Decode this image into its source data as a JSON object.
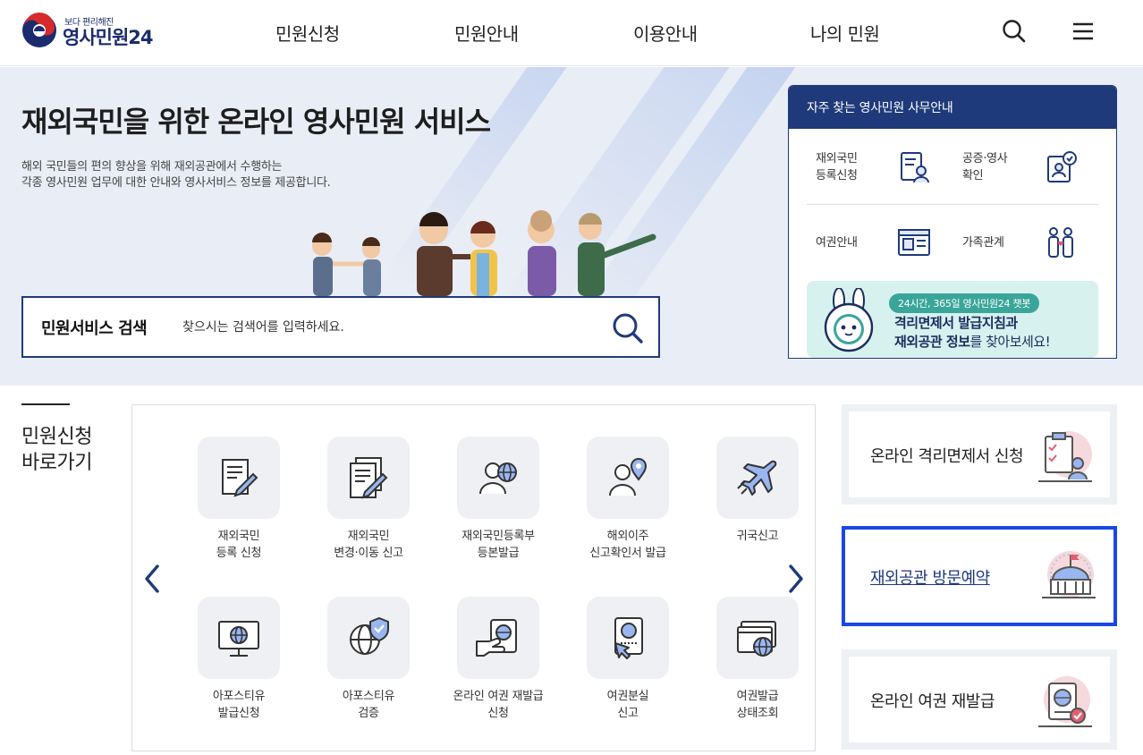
{
  "header": {
    "logo_sub": "보다 편리해진",
    "logo_main": "영사민원24",
    "nav": [
      "민원신청",
      "민원안내",
      "이용안내",
      "나의 민원"
    ]
  },
  "hero": {
    "title": "재외국민을 위한 온라인 영사민원 서비스",
    "desc_line1": "해외 국민들의 편의 향상을 위해 재외공관에서 수행하는",
    "desc_line2": "각종 영사민원 업무에 대한 안내와 영사서비스 정보를 제공합니다."
  },
  "search": {
    "label": "민원서비스 검색",
    "placeholder": "찾으시는 검색어를 입력하세요."
  },
  "faq": {
    "title": "자주 찾는 영사민원 사무안내",
    "items": [
      {
        "line1": "재외국민",
        "line2": "등록신청",
        "icon": "document-person-icon"
      },
      {
        "line1": "공증·영사",
        "line2": "확인",
        "icon": "certificate-check-icon"
      },
      {
        "line1": "여권안내",
        "line2": "",
        "icon": "passport-id-icon"
      },
      {
        "line1": "가족관계",
        "line2": "",
        "icon": "family-icon"
      }
    ],
    "banner": {
      "tag": "24시간, 365일 영사민원24 챗봇",
      "line1": "격리면제서 발급지침과",
      "line2_bold": "재외공관 정보",
      "line2_light": "를 찾아보세요!"
    }
  },
  "quick": {
    "title_line1": "민원신청",
    "title_line2": "바로가기",
    "items": [
      {
        "line1": "재외국민",
        "line2": "등록 신청",
        "icon": "form-pen-icon"
      },
      {
        "line1": "재외국민",
        "line2": "변경·이동 신고",
        "icon": "forms-pen-icon"
      },
      {
        "line1": "재외국민등록부",
        "line2": "등본발급",
        "icon": "person-globe-icon"
      },
      {
        "line1": "해외이주",
        "line2": "신고확인서 발급",
        "icon": "person-location-icon"
      },
      {
        "line1": "귀국신고",
        "line2": "",
        "icon": "airplane-icon"
      },
      {
        "line1": "아포스티유",
        "line2": "발급신청",
        "icon": "monitor-globe-icon"
      },
      {
        "line1": "아포스티유",
        "line2": "검증",
        "icon": "globe-shield-icon"
      },
      {
        "line1": "온라인 여권 재발급",
        "line2": "신청",
        "icon": "hand-passport-icon"
      },
      {
        "line1": "여권분실",
        "line2": "신고",
        "icon": "passport-cursor-icon"
      },
      {
        "line1": "여권발급",
        "line2": "상태조회",
        "icon": "window-globe-icon"
      }
    ]
  },
  "side_cards": [
    {
      "label": "온라인 격리면제서 신청",
      "icon": "clipboard-person-icon"
    },
    {
      "label": "재외공관 방문예약",
      "icon": "embassy-building-icon"
    },
    {
      "label": "온라인 여권 재발급",
      "icon": "passport-check-icon"
    }
  ]
}
